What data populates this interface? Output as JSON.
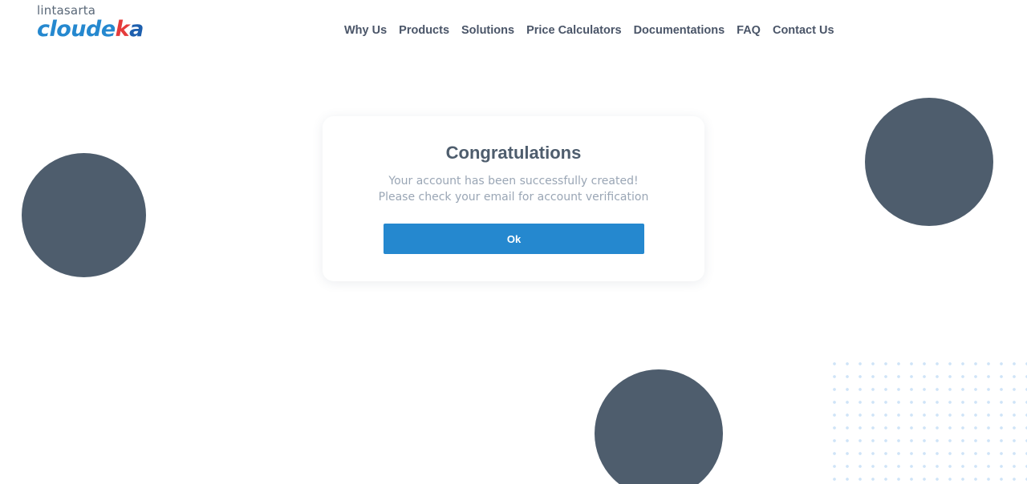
{
  "header": {
    "logo": {
      "top_text": "lintasarta",
      "brand_part1": "cloude",
      "brand_part2": "k",
      "brand_part3": "a"
    },
    "nav": [
      {
        "label": "Why Us"
      },
      {
        "label": "Products"
      },
      {
        "label": "Solutions"
      },
      {
        "label": "Price Calculators"
      },
      {
        "label": "Documentations"
      },
      {
        "label": "FAQ"
      },
      {
        "label": "Contact Us"
      }
    ]
  },
  "dialog": {
    "title": "Congratulations",
    "message_line1": "Your account has been successfully created!",
    "message_line2": "Please check your email for account verification",
    "ok_label": "Ok"
  },
  "colors": {
    "brand_blue": "#2588cf",
    "brand_red": "#e53b3b",
    "circle_fill": "#4e5d6d",
    "text_muted": "#9aa6b5"
  }
}
